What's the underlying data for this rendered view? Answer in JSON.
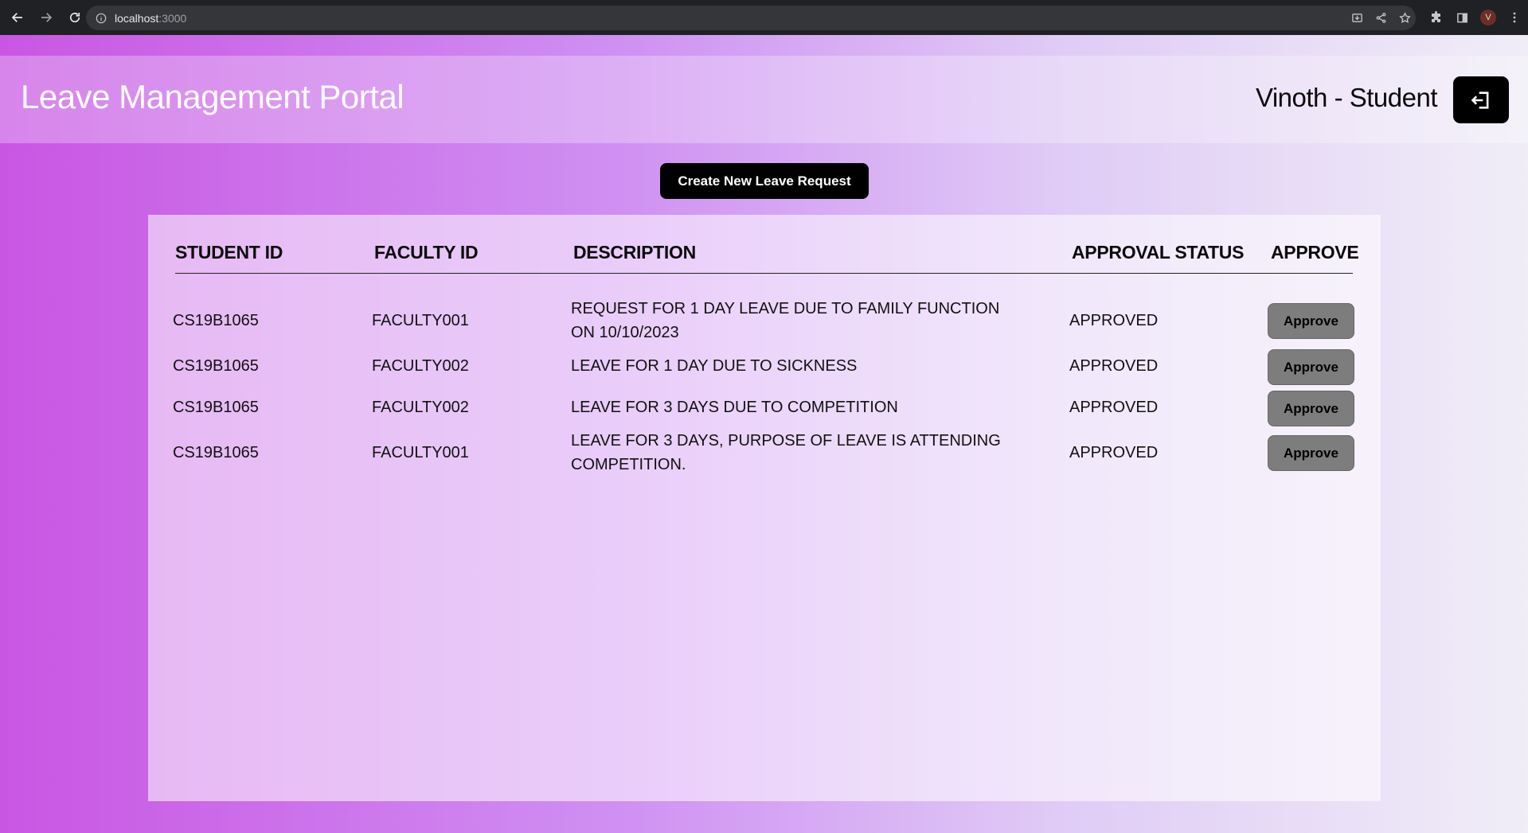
{
  "browser": {
    "url_host": "localhost",
    "url_port": ":3000",
    "avatar_letter": "V"
  },
  "header": {
    "title": "Leave Management Portal",
    "user_label": "Vinoth - Student"
  },
  "actions": {
    "create_label": "Create New Leave Request"
  },
  "table": {
    "columns": [
      "STUDENT ID",
      "FACULTY ID",
      "DESCRIPTION",
      "APPROVAL STATUS",
      "APPROVE"
    ],
    "rows": [
      {
        "student_id": "CS19B1065",
        "faculty_id": "FACULTY001",
        "description": "REQUEST FOR 1 DAY LEAVE DUE TO FAMILY FUNCTION ON 10/10/2023",
        "status": "APPROVED",
        "action": "Approve"
      },
      {
        "student_id": "CS19B1065",
        "faculty_id": "FACULTY002",
        "description": "LEAVE FOR 1 DAY DUE TO SICKNESS",
        "status": "APPROVED",
        "action": "Approve"
      },
      {
        "student_id": "CS19B1065",
        "faculty_id": "FACULTY002",
        "description": "LEAVE FOR 3 DAYS DUE TO COMPETITION",
        "status": "APPROVED",
        "action": "Approve"
      },
      {
        "student_id": "CS19B1065",
        "faculty_id": "FACULTY001",
        "description": "LEAVE FOR 3 DAYS, PURPOSE OF LEAVE IS ATTENDING COMPETITION.",
        "status": "APPROVED",
        "action": "Approve"
      }
    ]
  },
  "colors": {
    "gradient_start": "#c956e3",
    "gradient_end": "#f0edf7",
    "button_dark": "#000000",
    "approve_button": "#7d7d7d"
  }
}
